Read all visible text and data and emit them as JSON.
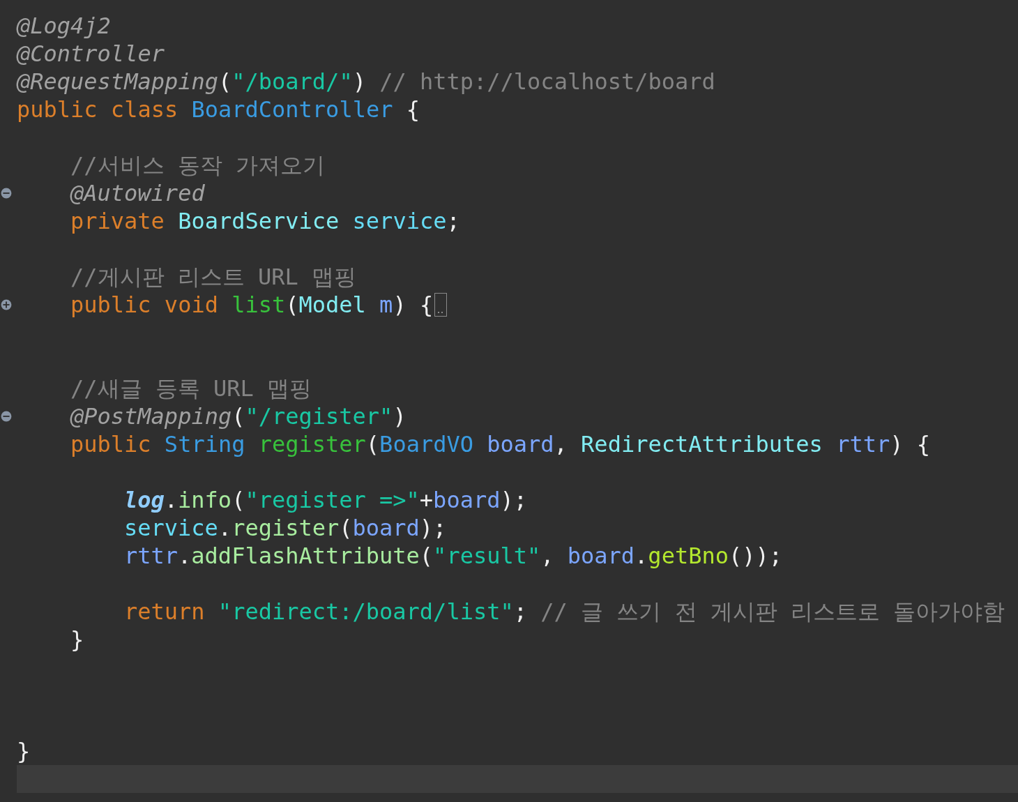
{
  "lines": [
    {
      "kind": "code",
      "tokens": [
        {
          "text": "@Log4j2",
          "kind": "annotation"
        }
      ]
    },
    {
      "kind": "code",
      "tokens": [
        {
          "text": "@Controller",
          "kind": "annotation"
        }
      ]
    },
    {
      "kind": "code",
      "tokens": [
        {
          "text": "@RequestMapping",
          "kind": "annotation"
        },
        {
          "text": "(",
          "kind": "punct"
        },
        {
          "text": "\"/board/\"",
          "kind": "string"
        },
        {
          "text": ") ",
          "kind": "punct"
        },
        {
          "text": "// http://localhost/board",
          "kind": "comment"
        }
      ]
    },
    {
      "kind": "code",
      "tokens": [
        {
          "text": "public class ",
          "kind": "keyword"
        },
        {
          "text": "BoardController",
          "kind": "class"
        },
        {
          "text": " {",
          "kind": "punct"
        }
      ]
    },
    {
      "kind": "blank"
    },
    {
      "kind": "code",
      "tokens": [
        {
          "text": "\t//서비스 동작 가져오기",
          "kind": "comment"
        }
      ]
    },
    {
      "kind": "code",
      "folded": false,
      "tokens": [
        {
          "text": "\t@Autowired",
          "kind": "annotation"
        }
      ]
    },
    {
      "kind": "code",
      "tokens": [
        {
          "text": "\tprivate ",
          "kind": "keyword"
        },
        {
          "text": "BoardService ",
          "kind": "type"
        },
        {
          "text": "service",
          "kind": "field"
        },
        {
          "text": ";",
          "kind": "punct"
        }
      ]
    },
    {
      "kind": "blank"
    },
    {
      "kind": "code",
      "tokens": [
        {
          "text": "\t//게시판 리스트 URL 맵핑",
          "kind": "comment"
        }
      ]
    },
    {
      "kind": "code",
      "folded": true,
      "tokens": [
        {
          "text": "\tpublic void ",
          "kind": "keyword"
        },
        {
          "text": "list",
          "kind": "method"
        },
        {
          "text": "(",
          "kind": "punct"
        },
        {
          "text": "Model ",
          "kind": "type"
        },
        {
          "text": "m",
          "kind": "param"
        },
        {
          "text": ") {",
          "kind": "punct"
        }
      ]
    },
    {
      "kind": "blank"
    },
    {
      "kind": "blank"
    },
    {
      "kind": "code",
      "tokens": [
        {
          "text": "\t//새글 등록 URL 맵핑",
          "kind": "comment"
        }
      ]
    },
    {
      "kind": "code",
      "folded": false,
      "tokens": [
        {
          "text": "\t@PostMapping",
          "kind": "annotation"
        },
        {
          "text": "(",
          "kind": "punct"
        },
        {
          "text": "\"/register\"",
          "kind": "string"
        },
        {
          "text": ")",
          "kind": "punct"
        }
      ]
    },
    {
      "kind": "code",
      "tokens": [
        {
          "text": "\tpublic ",
          "kind": "keyword"
        },
        {
          "text": "String ",
          "kind": "class"
        },
        {
          "text": "register",
          "kind": "method"
        },
        {
          "text": "(",
          "kind": "punct"
        },
        {
          "text": "BoardVO ",
          "kind": "class"
        },
        {
          "text": "board",
          "kind": "param"
        },
        {
          "text": ", ",
          "kind": "punct"
        },
        {
          "text": "RedirectAttributes ",
          "kind": "type"
        },
        {
          "text": "rttr",
          "kind": "param"
        },
        {
          "text": ") {",
          "kind": "punct"
        }
      ]
    },
    {
      "kind": "blank"
    },
    {
      "kind": "code",
      "tokens": [
        {
          "text": "\t\tlog",
          "kind": "static"
        },
        {
          "text": ".",
          "kind": "punct"
        },
        {
          "text": "info",
          "kind": "call"
        },
        {
          "text": "(",
          "kind": "punct"
        },
        {
          "text": "\"register =>\"",
          "kind": "string"
        },
        {
          "text": "+",
          "kind": "punct"
        },
        {
          "text": "board",
          "kind": "param"
        },
        {
          "text": ");",
          "kind": "punct"
        }
      ]
    },
    {
      "kind": "code",
      "tokens": [
        {
          "text": "\t\tservice",
          "kind": "field"
        },
        {
          "text": ".",
          "kind": "punct"
        },
        {
          "text": "register",
          "kind": "call"
        },
        {
          "text": "(",
          "kind": "punct"
        },
        {
          "text": "board",
          "kind": "param"
        },
        {
          "text": ");",
          "kind": "punct"
        }
      ]
    },
    {
      "kind": "code",
      "tokens": [
        {
          "text": "\t\trttr",
          "kind": "param"
        },
        {
          "text": ".",
          "kind": "punct"
        },
        {
          "text": "addFlashAttribute",
          "kind": "call"
        },
        {
          "text": "(",
          "kind": "punct"
        },
        {
          "text": "\"result\"",
          "kind": "string"
        },
        {
          "text": ", ",
          "kind": "punct"
        },
        {
          "text": "board",
          "kind": "param"
        },
        {
          "text": ".",
          "kind": "punct"
        },
        {
          "text": "getBno",
          "kind": "getter"
        },
        {
          "text": "());",
          "kind": "punct"
        }
      ]
    },
    {
      "kind": "blank"
    },
    {
      "kind": "code",
      "tokens": [
        {
          "text": "\t\treturn ",
          "kind": "keyword"
        },
        {
          "text": "\"redirect:/board/list\"",
          "kind": "string"
        },
        {
          "text": "; ",
          "kind": "punct"
        },
        {
          "text": "// 글 쓰기 전 게시판 리스트로 돌아가야함",
          "kind": "comment"
        }
      ]
    },
    {
      "kind": "code",
      "tokens": [
        {
          "text": "\t}",
          "kind": "punct"
        }
      ]
    },
    {
      "kind": "blank"
    },
    {
      "kind": "blank"
    },
    {
      "kind": "blank"
    },
    {
      "kind": "code",
      "tokens": [
        {
          "text": "}",
          "kind": "punct"
        }
      ]
    },
    {
      "kind": "blank",
      "current": true
    }
  ]
}
